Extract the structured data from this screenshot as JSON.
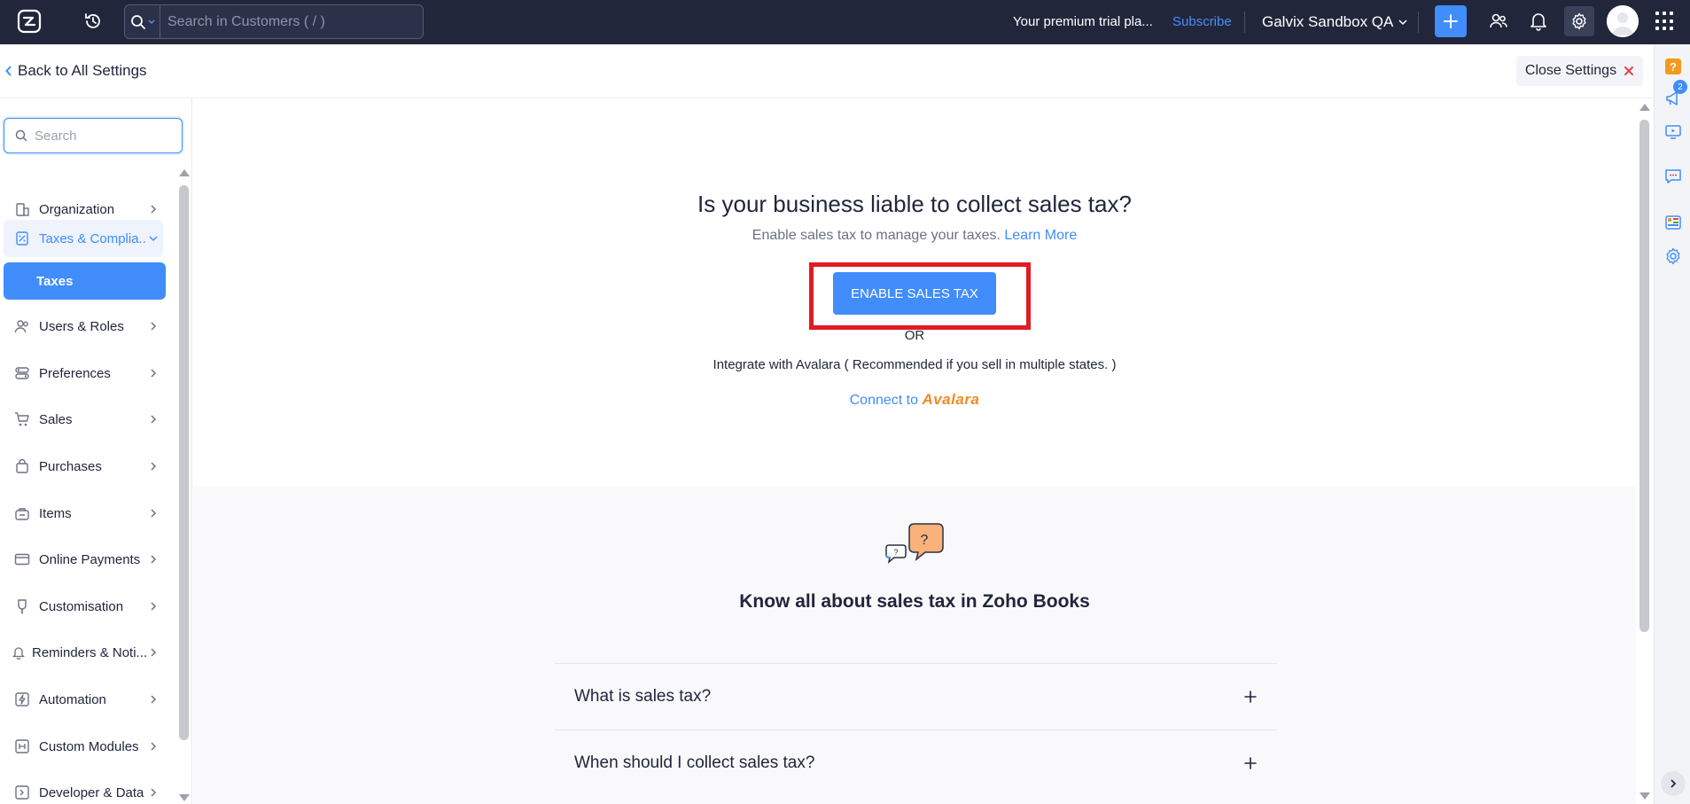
{
  "topbar": {
    "search_placeholder": "Search in Customers ( / )",
    "trial_text": "Your premium trial pla...",
    "subscribe_label": "Subscribe",
    "org_name": "Galvix Sandbox QA",
    "accent_color": "#408dfb",
    "bar_color": "#21263b"
  },
  "settings_header": {
    "back_label": "Back to All Settings",
    "close_label": "Close Settings"
  },
  "sidebar": {
    "search_placeholder": "Search",
    "items": [
      {
        "label": "Organization",
        "icon": "organization-icon"
      },
      {
        "label": "Taxes & Complia...",
        "icon": "taxes-icon"
      },
      {
        "label": "Users & Roles",
        "icon": "users-icon"
      },
      {
        "label": "Preferences",
        "icon": "preferences-icon"
      },
      {
        "label": "Sales",
        "icon": "cart-icon"
      },
      {
        "label": "Purchases",
        "icon": "bag-icon"
      },
      {
        "label": "Items",
        "icon": "items-icon"
      },
      {
        "label": "Online Payments",
        "icon": "card-icon"
      },
      {
        "label": "Customisation",
        "icon": "brush-icon"
      },
      {
        "label": "Reminders & Noti...",
        "icon": "bell-icon"
      },
      {
        "label": "Automation",
        "icon": "bolt-icon"
      },
      {
        "label": "Custom Modules",
        "icon": "modules-icon"
      },
      {
        "label": "Developer & Data",
        "icon": "code-icon"
      }
    ],
    "sub_item": "Taxes"
  },
  "main": {
    "title": "Is your business liable to collect sales tax?",
    "subtitle": "Enable sales tax to manage your taxes.",
    "learn_more": "Learn More",
    "enable_button": "ENABLE SALES TAX",
    "or_text": "OR",
    "avalara_text": "Integrate with Avalara ( Recommended if you sell in multiple states. )",
    "connect_text": "Connect to",
    "connect_brand": "Avalara",
    "know_title": "Know all about sales tax in Zoho Books",
    "faqs": [
      {
        "question": "What is sales tax?"
      },
      {
        "question": "When should I collect sales tax?"
      }
    ]
  },
  "rail": {
    "badge_count": "2"
  }
}
